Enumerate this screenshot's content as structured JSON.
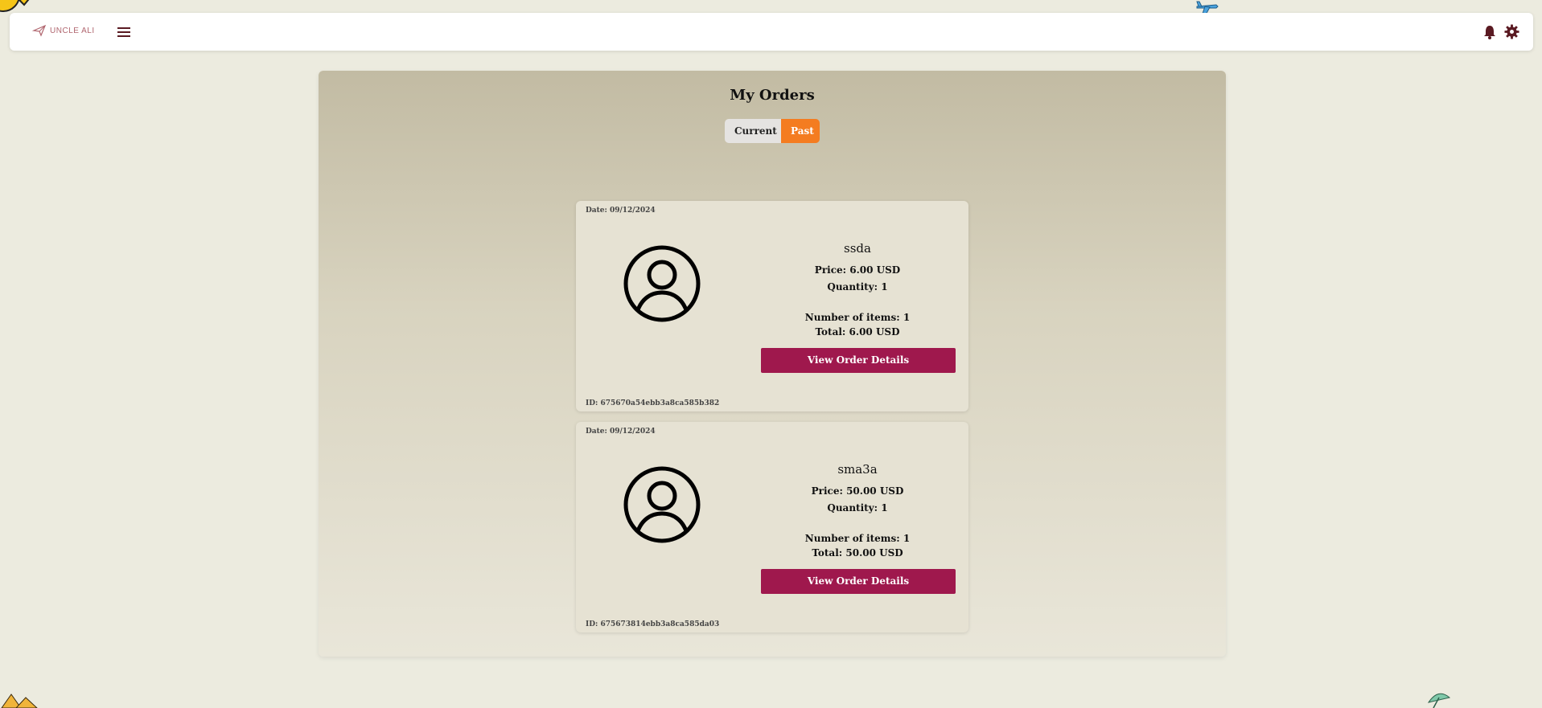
{
  "header": {
    "logo_text": "UNCLE ALI",
    "icons": [
      "menu-icon",
      "bell-icon",
      "gear-icon"
    ]
  },
  "page": {
    "title": "My Orders",
    "tabs": [
      {
        "label": "Current",
        "active": false
      },
      {
        "label": "Past",
        "active": true
      }
    ]
  },
  "orders": [
    {
      "date": "Date: 09/12/2024",
      "name": "ssda",
      "price": "Price: 6.00 USD",
      "quantity": "Quantity: 1",
      "items": "Number of items: 1",
      "total": "Total: 6.00 USD",
      "button": "View Order Details",
      "id": "ID: 675670a54ebb3a8ca585b382"
    },
    {
      "date": "Date: 09/12/2024",
      "name": "sma3a",
      "price": "Price: 50.00 USD",
      "quantity": "Quantity: 1",
      "items": "Number of items: 1",
      "total": "Total: 50.00 USD",
      "button": "View Order Details",
      "id": "ID: 675673814ebb3a8ca585da03"
    }
  ],
  "colors": {
    "accent": "#f47c20",
    "button": "#9f184d",
    "icon": "#5a1a22"
  }
}
